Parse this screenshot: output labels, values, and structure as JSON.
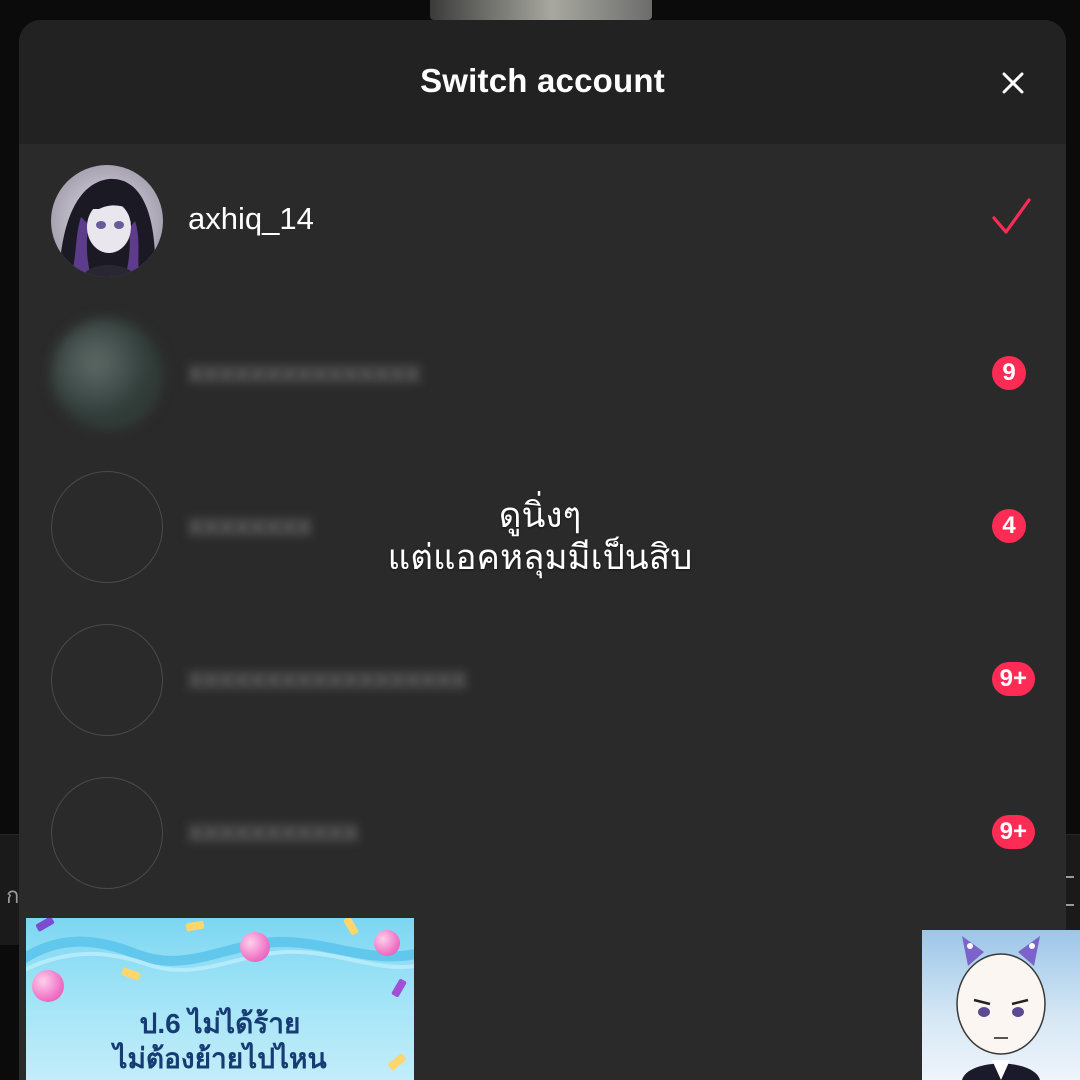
{
  "modal": {
    "title": "Switch account",
    "close_icon": "close-icon"
  },
  "accounts": [
    {
      "username": "axhiq_14",
      "selected": true,
      "indicator_icon": "checkmark-icon"
    },
    {
      "username": "",
      "blurred": true,
      "badge": "9"
    },
    {
      "username": "",
      "blurred": true,
      "badge": "4"
    },
    {
      "username": "",
      "blurred": true,
      "badge": "9+"
    },
    {
      "username": "",
      "blurred": true,
      "badge": "9+"
    }
  ],
  "overlay_caption": {
    "line1": "ดูนิ่งๆ",
    "line2": "แต่แอคหลุมมีเป็นสิบ"
  },
  "sticker_left": {
    "line1": "ป.6 ไม่ได้ร้าย",
    "line2": "ไม่ต้องย้ายไปไหน"
  },
  "colors": {
    "accent": "#fe2c55",
    "modal_bg": "#2a2a2a",
    "header_bg": "#222222",
    "text": "#ffffff"
  }
}
